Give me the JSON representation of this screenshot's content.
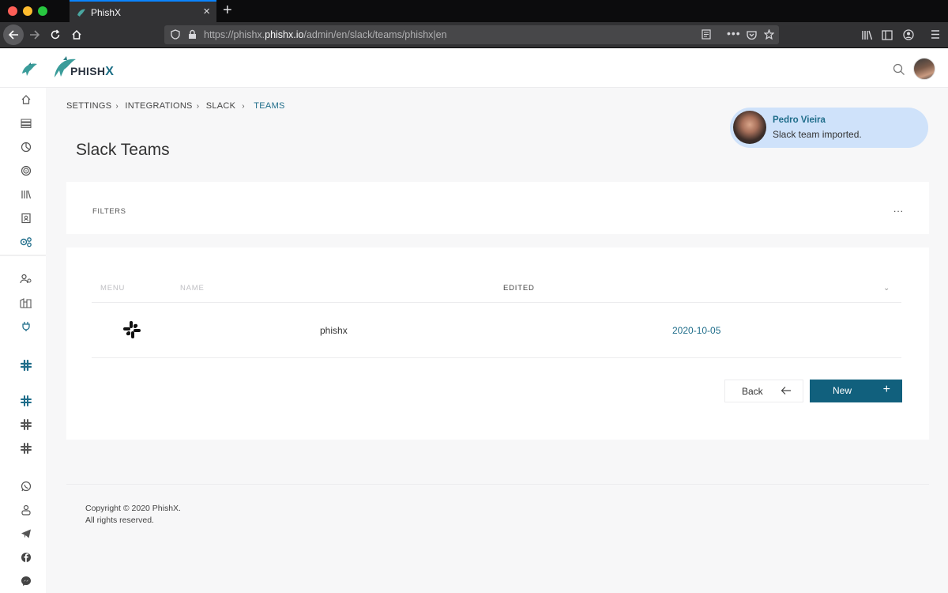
{
  "browser": {
    "tab_title": "PhishX",
    "url_prefix": "https://phishx.",
    "url_domain": "phishx.io",
    "url_path": "/admin/en/slack/teams/phishx|en"
  },
  "header": {
    "brand_main": "PHISH",
    "brand_accent": "X"
  },
  "breadcrumb": {
    "items": [
      "SETTINGS",
      "INTEGRATIONS",
      "SLACK",
      "TEAMS"
    ]
  },
  "page": {
    "title": "Slack Teams"
  },
  "toast": {
    "name": "Pedro Vieira",
    "message": "Slack team imported."
  },
  "filters": {
    "label": "FILTERS",
    "more": "..."
  },
  "table": {
    "columns": [
      "MENU",
      "NAME",
      "EDITED"
    ],
    "rows": [
      {
        "name": "phishx",
        "edited": "2020-10-05"
      }
    ]
  },
  "actions": {
    "back_label": "Back",
    "new_label": "New"
  },
  "footer": {
    "line1": "Copyright © 2020 PhishX.",
    "line2": "All rights reserved."
  },
  "colors": {
    "accent": "#11607d",
    "link": "#1f6d8a",
    "toast_bg": "#cfe2fa"
  }
}
